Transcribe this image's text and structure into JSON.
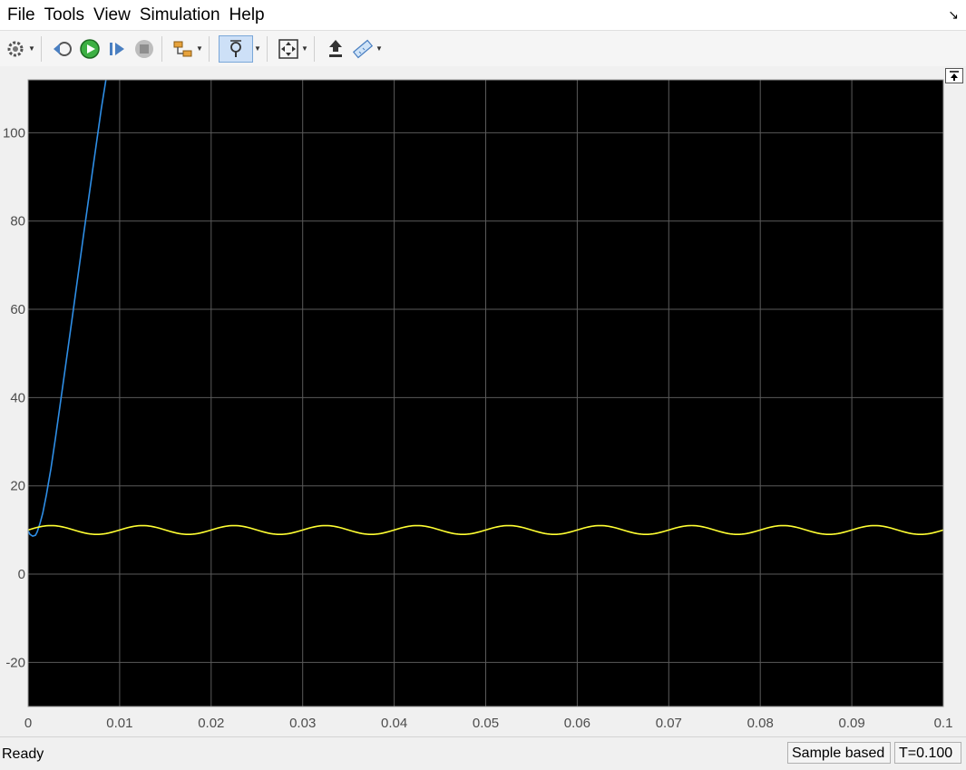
{
  "menu": {
    "file": "File",
    "tools": "Tools",
    "view": "View",
    "simulation": "Simulation",
    "help": "Help"
  },
  "toolbar": {
    "icons": [
      "settings-icon",
      "step-back-icon",
      "run-icon",
      "step-forward-icon",
      "stop-icon",
      "highlight-block-icon",
      "zoom-icon",
      "fit-to-view-icon",
      "restore-icon",
      "measure-icon"
    ]
  },
  "status": {
    "text": "Ready",
    "mode": "Sample based",
    "time": "T=0.100"
  },
  "chart_data": {
    "type": "line",
    "xlim": [
      0,
      0.1
    ],
    "ylim": [
      -30,
      112
    ],
    "x_ticks": [
      "0",
      "0.01",
      "0.02",
      "0.03",
      "0.04",
      "0.05",
      "0.06",
      "0.07",
      "0.08",
      "0.09",
      "0.1"
    ],
    "y_ticks": [
      "-20",
      "0",
      "20",
      "40",
      "60",
      "80",
      "100"
    ],
    "grid": true,
    "background": "#000000",
    "series": [
      {
        "color": "#2e8ee6",
        "x": [
          0,
          0.0002,
          0.0005,
          0.0008,
          0.001,
          0.0013,
          0.0016,
          0.002,
          0.0025,
          0.003,
          0.004,
          0.005,
          0.006,
          0.007,
          0.008,
          0.0085
        ],
        "y": [
          9.8,
          9.0,
          8.6,
          8.8,
          9.6,
          11.5,
          13.8,
          18.0,
          24.0,
          31.0,
          45.8,
          60.8,
          76.0,
          90.8,
          105.5,
          112.0
        ]
      },
      {
        "color": "#ffff33",
        "x": [
          0,
          0.0025,
          0.005,
          0.0075,
          0.01,
          0.0125,
          0.015,
          0.0175,
          0.02,
          0.0225,
          0.025,
          0.0275,
          0.03,
          0.0325,
          0.035,
          0.0375,
          0.04,
          0.0425,
          0.045,
          0.0475,
          0.05,
          0.0525,
          0.055,
          0.0575,
          0.06,
          0.0625,
          0.065,
          0.0675,
          0.07,
          0.0725,
          0.075,
          0.0775,
          0.08,
          0.0825,
          0.085,
          0.0875,
          0.09,
          0.0925,
          0.095,
          0.0975,
          0.1
        ],
        "y": [
          10,
          11,
          10,
          9,
          10,
          11,
          10,
          9,
          10,
          11,
          10,
          9,
          10,
          11,
          10,
          9,
          10,
          11,
          10,
          9,
          10,
          11,
          10,
          9,
          10,
          11,
          10,
          9,
          10,
          11,
          10,
          9,
          10,
          11,
          10,
          9,
          10,
          11,
          10,
          9,
          10
        ]
      }
    ]
  }
}
